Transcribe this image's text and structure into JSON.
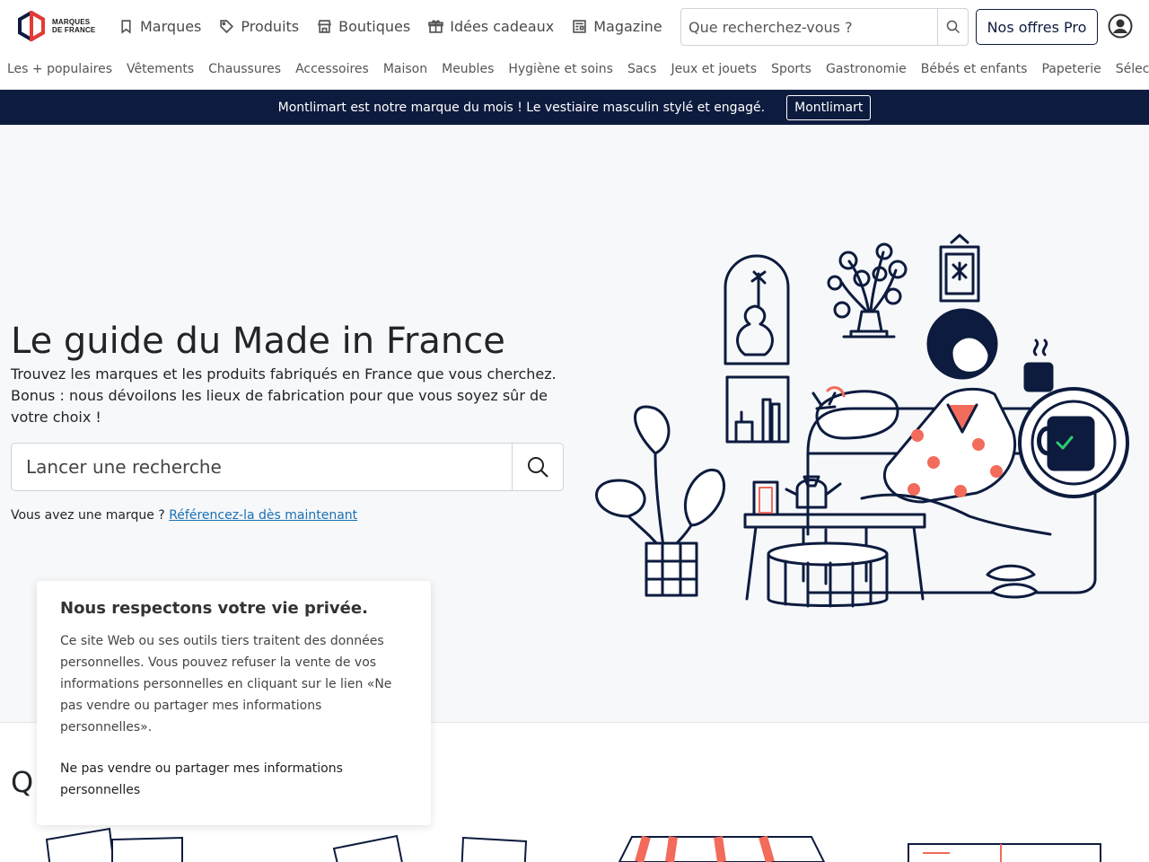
{
  "header": {
    "logo_line1": "MARQUES",
    "logo_line2": "DE FRANCE",
    "nav": [
      {
        "label": "Marques",
        "icon": "bookmark-icon"
      },
      {
        "label": "Produits",
        "icon": "tag-icon"
      },
      {
        "label": "Boutiques",
        "icon": "store-icon"
      },
      {
        "label": "Idées cadeaux",
        "icon": "gift-icon"
      },
      {
        "label": "Magazine",
        "icon": "newspaper-icon"
      }
    ],
    "search_placeholder": "Que recherchez-vous ?",
    "pro_button": "Nos offres Pro"
  },
  "categories": [
    "Les + populaires",
    "Vêtements",
    "Chaussures",
    "Accessoires",
    "Maison",
    "Meubles",
    "Hygiène et soins",
    "Sacs",
    "Jeux et jouets",
    "Sports",
    "Gastronomie",
    "Bébés et enfants",
    "Papeterie",
    "Sélec"
  ],
  "banner": {
    "text": "Montlimart est notre marque du mois ! Le vestiaire masculin stylé et engagé.",
    "button": "Montlimart"
  },
  "hero": {
    "title": "Le guide du Made in France",
    "subtitle": "Trouvez les marques et les produits fabriqués en France que vous cherchez. Bonus : nous dévoilons les lieux de fabrication pour que vous soyez sûr de votre choix !",
    "search_placeholder": "Lancer une recherche",
    "brand_prompt": "Vous avez une marque ?",
    "brand_link": "Référencez-la dès maintenant"
  },
  "section_heading_partial": "Q",
  "privacy": {
    "title": "Nous respectons votre vie privée.",
    "body": "Ce site Web ou ses outils tiers traitent des données personnelles. Vous pouvez refuser la vente de vos informations personnelles en cliquant sur le lien «Ne pas vendre ou partager mes informations personnelles».",
    "optout": "Ne pas vendre ou partager mes informations personnelles"
  },
  "colors": {
    "navy": "#0d1b3e",
    "coral": "#f26b5b",
    "link": "#1a6fb3",
    "logo_red": "#e53935"
  }
}
